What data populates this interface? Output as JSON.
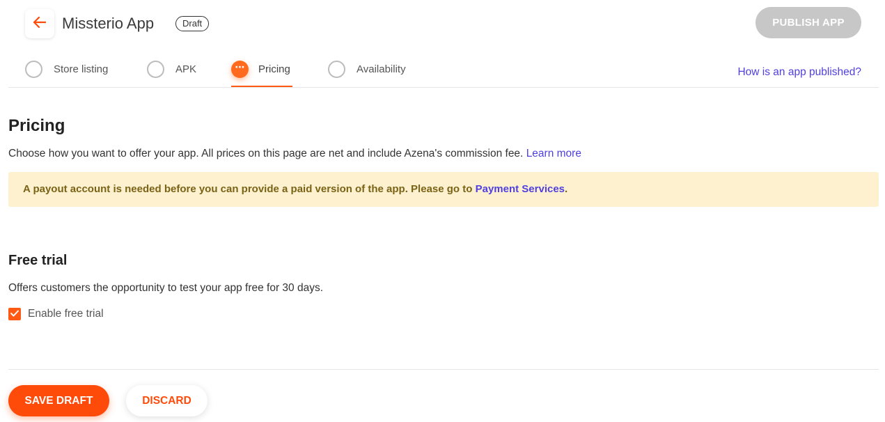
{
  "header": {
    "app_name": "Missterio App",
    "status_badge": "Draft",
    "publish_label": "PUBLISH APP"
  },
  "stepper": {
    "steps": [
      {
        "label": "Store listing",
        "state": "incomplete"
      },
      {
        "label": "APK",
        "state": "incomplete"
      },
      {
        "label": "Pricing",
        "state": "active"
      },
      {
        "label": "Availability",
        "state": "incomplete"
      }
    ],
    "active_icon": "⋯",
    "help_link": "How is an app published?"
  },
  "pricing": {
    "title": "Pricing",
    "description": "Choose how you want to offer your app. All prices on this page are net and include Azena's commission fee.",
    "learn_more": "Learn more",
    "notice_text": "A payout account is needed before you can provide a paid version of the app. Please go to",
    "notice_link": "Payment Services",
    "notice_end": "."
  },
  "free_trial": {
    "title": "Free trial",
    "description": "Offers customers the opportunity to test your app free for 30 days.",
    "checkbox_label": "Enable free trial",
    "checked": true
  },
  "footer": {
    "save_label": "SAVE DRAFT",
    "discard_label": "DISCARD"
  },
  "colors": {
    "accent": "#ff4b0a",
    "link": "#4f3fe0",
    "notice_bg": "#fdf1cf",
    "notice_text": "#7a6316",
    "disabled": "#c7c7c7"
  }
}
